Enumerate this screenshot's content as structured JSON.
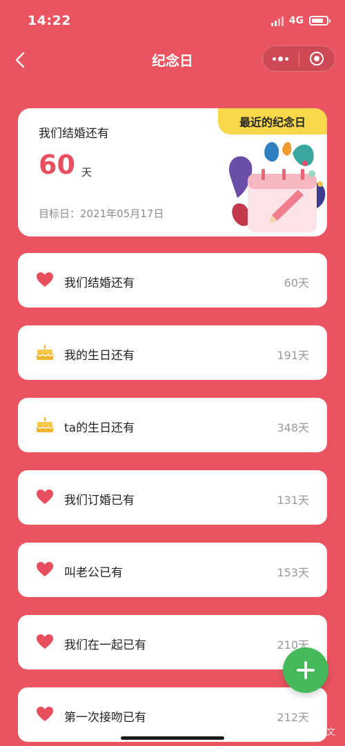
{
  "status_bar": {
    "time": "14:22",
    "network": "4G"
  },
  "nav": {
    "title": "纪念日",
    "back_icon": "chevron-left-icon",
    "more_icon": "more-dots-icon",
    "close_icon": "target-circle-icon"
  },
  "hero": {
    "badge": "最近的纪念日",
    "title": "我们结婚还有",
    "count": "60",
    "unit": "天",
    "date": "目标日：2021年05月17日",
    "illustration": "calendar-plants-illustration"
  },
  "items": [
    {
      "icon": "heart-icon",
      "label": "我们结婚还有",
      "value": "60天"
    },
    {
      "icon": "cake-icon",
      "label": "我的生日还有",
      "value": "191天"
    },
    {
      "icon": "cake-icon",
      "label": "ta的生日还有",
      "value": "348天"
    },
    {
      "icon": "heart-icon",
      "label": "我们订婚已有",
      "value": "131天"
    },
    {
      "icon": "heart-icon",
      "label": "叫老公已有",
      "value": "153天"
    },
    {
      "icon": "heart-icon",
      "label": "我们在一起已有",
      "value": "210天"
    },
    {
      "icon": "heart-icon",
      "label": "第一次接吻已有",
      "value": "212天"
    }
  ],
  "fab": {
    "icon": "plus-icon"
  },
  "watermark": "知乎 @华文",
  "colors": {
    "background": "#ea5461",
    "accent": "#e84f5e",
    "badge": "#f7d84a",
    "fab": "#46b95a"
  }
}
